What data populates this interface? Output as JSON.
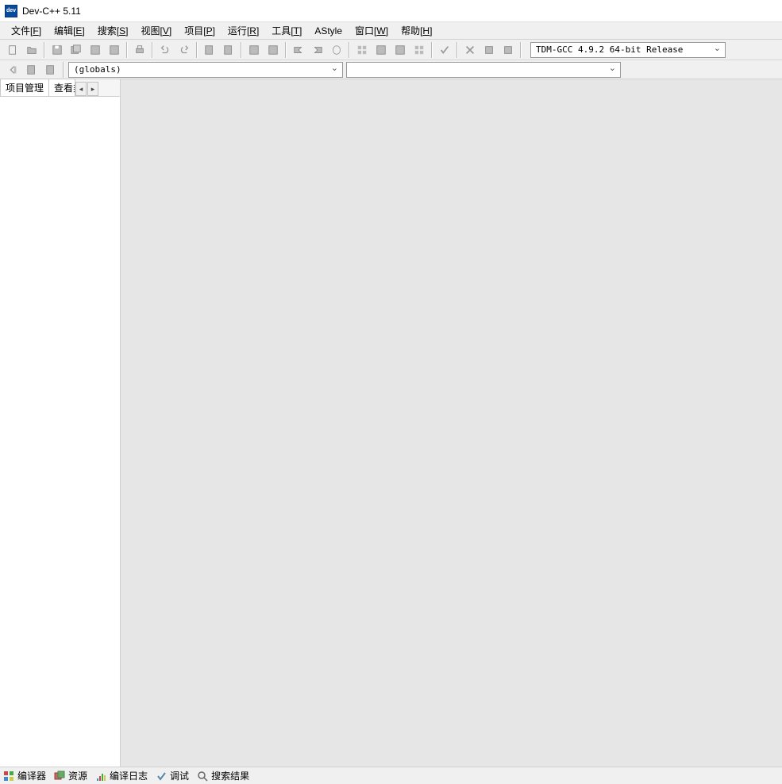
{
  "title": "Dev-C++ 5.11",
  "menu": [
    {
      "label": "文件",
      "hotkey": "F"
    },
    {
      "label": "编辑",
      "hotkey": "E"
    },
    {
      "label": "搜索",
      "hotkey": "S"
    },
    {
      "label": "视图",
      "hotkey": "V"
    },
    {
      "label": "项目",
      "hotkey": "P"
    },
    {
      "label": "运行",
      "hotkey": "R"
    },
    {
      "label": "工具",
      "hotkey": "T"
    },
    {
      "label": "AStyle",
      "hotkey": ""
    },
    {
      "label": "窗口",
      "hotkey": "W"
    },
    {
      "label": "帮助",
      "hotkey": "H"
    }
  ],
  "compiler": {
    "selected": "TDM-GCC 4.9.2 64-bit Release"
  },
  "scope": {
    "globals": "(globals)",
    "members": ""
  },
  "left_tabs": {
    "project": "项目管理",
    "classes": "查看类"
  },
  "bottom": {
    "compiler": "编译器",
    "resources": "资源",
    "compile_log": "编译日志",
    "debug": "调试",
    "search_results": "搜索结果"
  }
}
